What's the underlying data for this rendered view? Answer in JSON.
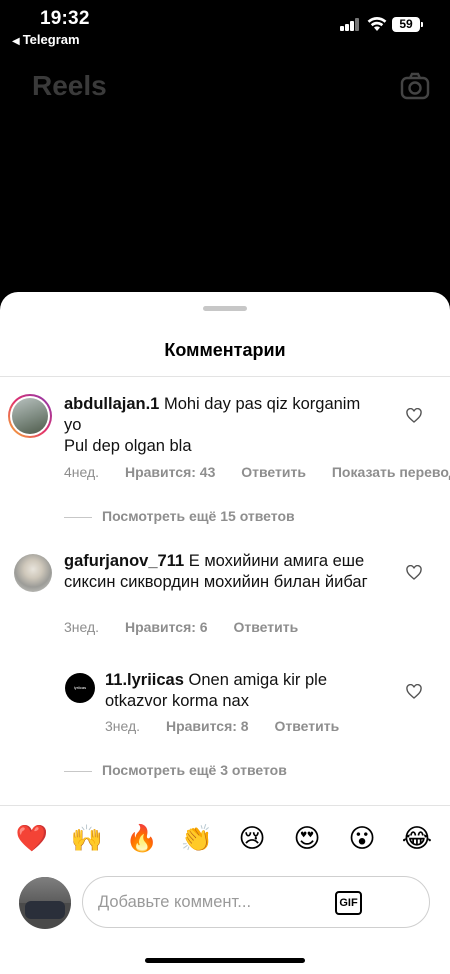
{
  "status_bar": {
    "time": "19:32",
    "back_app": "Telegram",
    "battery": "59"
  },
  "header": {
    "title": "Reels"
  },
  "sheet": {
    "title": "Комментарии",
    "comments": [
      {
        "username": "abdullajan.1",
        "text": "Mohi day pas qiz korganim yo\nPul dep olgan bla",
        "time": "4нед.",
        "likes": "Нравится: 43",
        "reply": "Ответить",
        "translate": "Показать перевод",
        "more_replies": "Посмотреть ещё 15 ответов"
      },
      {
        "username": "gafurjanov_711",
        "text": "Е мохийини амига еше сиксин сиквордин мохийин билан йибаг",
        "time": "3нед.",
        "likes": "Нравится: 6",
        "reply": "Ответить"
      },
      {
        "username": "11.lyriicas",
        "text": "Onen amiga kir  ple otkazvor korma nax",
        "time": "3нед.",
        "likes": "Нравится: 8",
        "reply": "Ответить",
        "more_replies": "Посмотреть ещё 3 ответов"
      }
    ]
  },
  "emoji_bar": [
    "❤️",
    "🙌",
    "🔥",
    "👏",
    "😢",
    "😍",
    "😮",
    "😂"
  ],
  "composer": {
    "placeholder": "Добавьте коммент...",
    "gif_label": "GIF"
  }
}
